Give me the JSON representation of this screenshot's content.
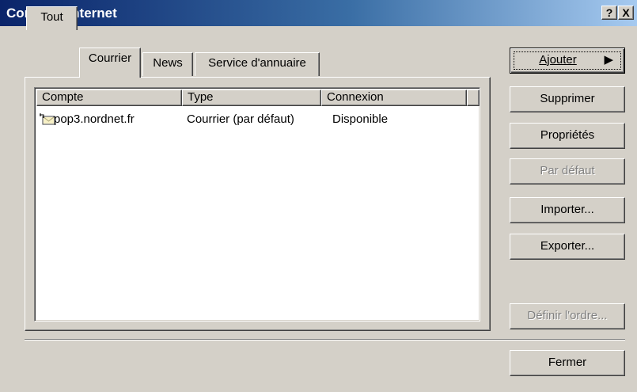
{
  "window": {
    "title": "Comptes Internet",
    "help_button": "?",
    "close_button": "X"
  },
  "tabs": [
    {
      "label": "Tout",
      "active": false
    },
    {
      "label": "Courrier",
      "active": true
    },
    {
      "label": "News",
      "active": false
    },
    {
      "label": "Service d'annuaire",
      "active": false
    }
  ],
  "table": {
    "columns": [
      "Compte",
      "Type",
      "Connexion"
    ],
    "rows": [
      {
        "compte": "pop3.nordnet.fr",
        "type": "Courrier (par défaut)",
        "connexion": "Disponible",
        "icon": "mail-account-icon"
      }
    ]
  },
  "buttons": {
    "ajouter": "Ajouter",
    "supprimer": "Supprimer",
    "proprietes": "Propriétés",
    "par_defaut": "Par défaut",
    "importer": "Importer...",
    "exporter": "Exporter...",
    "definir_ordre": "Définir l'ordre...",
    "fermer": "Fermer"
  },
  "colors": {
    "dialog_bg": "#d4d0c8",
    "title_gradient_start": "#0a246a",
    "title_gradient_end": "#a6caf0"
  }
}
